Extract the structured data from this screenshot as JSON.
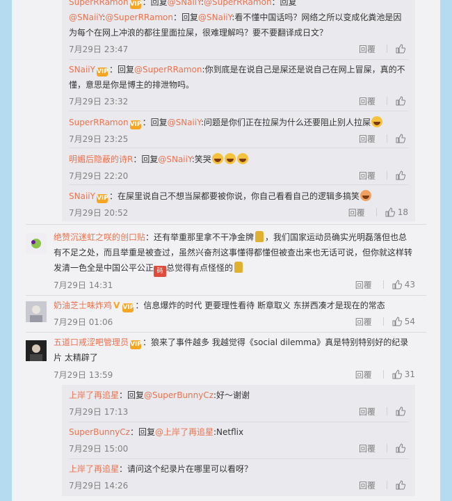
{
  "ui": {
    "reply_label": "回覆",
    "like_icon": "thumb-up-icon"
  },
  "sub1": {
    "r0": {
      "user": "SuperRRamon",
      "t1": "：回复",
      "at1": "@SNaiiY",
      "t2": ":",
      "at2": "@SuperRRamon",
      "t3": "：回复",
      "at3": "@SNaiiY",
      "t4": ":",
      "at4": "@SuperRRamon",
      "t5": "：回复",
      "at5": "@SNaiiY",
      "t6": ":看不懂中国话吗？网络之所以变成化粪池是因为每个在网上冲浪的都往里面拉屎，很难理解吗？要不要翻译成日文？",
      "time": "7月29日 23:47",
      "likes": ""
    },
    "r1": {
      "user": "SNaiiY",
      "t1": "：回复",
      "at1": "@SuperRRamon",
      "t2": ":你到底是在说自己是屎还是说自己在网上冒屎，真的不懂，意思是你是博主的排泄物吗。",
      "time": "7月29日 23:32",
      "likes": ""
    },
    "r2": {
      "user": "SuperRRamon",
      "t1": "：回复",
      "at1": "@SNaiiY",
      "t2": ":问题是你们正在拉屎为什么还要阻止别人拉屎",
      "time": "7月29日 23:25",
      "likes": ""
    },
    "r3": {
      "user": "明媚后隐蔽的诗R",
      "t1": "：回复",
      "at1": "@SNaiiY",
      "t2": ":笑哭",
      "time": "7月29日 22:20",
      "likes": ""
    },
    "r4": {
      "user": "SNaiiY",
      "t1": "：在屎里说自己不想当屎都要被你说，你自己看看自己的逻辑多搞笑",
      "time": "7月29日 20:52",
      "likes": "18"
    }
  },
  "c1": {
    "user": "绝赞沉迷虹之咲的创口贴",
    "t1": "：还有举重那里拿不干净金牌",
    "t2": "，我们国家运动员确实光明磊落但也总有不足之处，而且举重是被查过，虽然兴奋剂这事懂得都懂但被查出来也无话可说，但你就这样转发清一色全是中国公平公正",
    "badge": "码",
    "t3": "总觉得有点怪怪的",
    "time": "7月29日 14:31",
    "likes": "43"
  },
  "c2": {
    "user": "奶油芝士味炸鸡",
    "v": "V",
    "t1": "：信息爆炸的时代 更要理性看待 断章取义 东拼西凑才是现在的常态",
    "time": "7月29日 01:06",
    "likes": "54"
  },
  "c3": {
    "user": "五道口戒涩吧管理员",
    "t1": "：狼来了事件越多 我越觉得《social dilemma》真是特别特别好的纪录片  太精辟了",
    "time": "7月29日 13:59",
    "likes": "31"
  },
  "sub2": {
    "r0": {
      "user": "上岸了再追星",
      "t1": "：回复",
      "at1": "@SuperBunnyCz",
      "t2": ":好～谢谢",
      "time": "7月29日 17:13",
      "likes": ""
    },
    "r1": {
      "user": "SuperBunnyCz",
      "t1": "：回复",
      "at1": "@上岸了再追星",
      "t2": ":Netflix",
      "time": "7月29日 15:00",
      "likes": ""
    },
    "r2": {
      "user": "上岸了再追星",
      "t1": "：请问这个纪录片在哪里可以看呀？",
      "time": "7月29日 14:26",
      "likes": ""
    }
  }
}
